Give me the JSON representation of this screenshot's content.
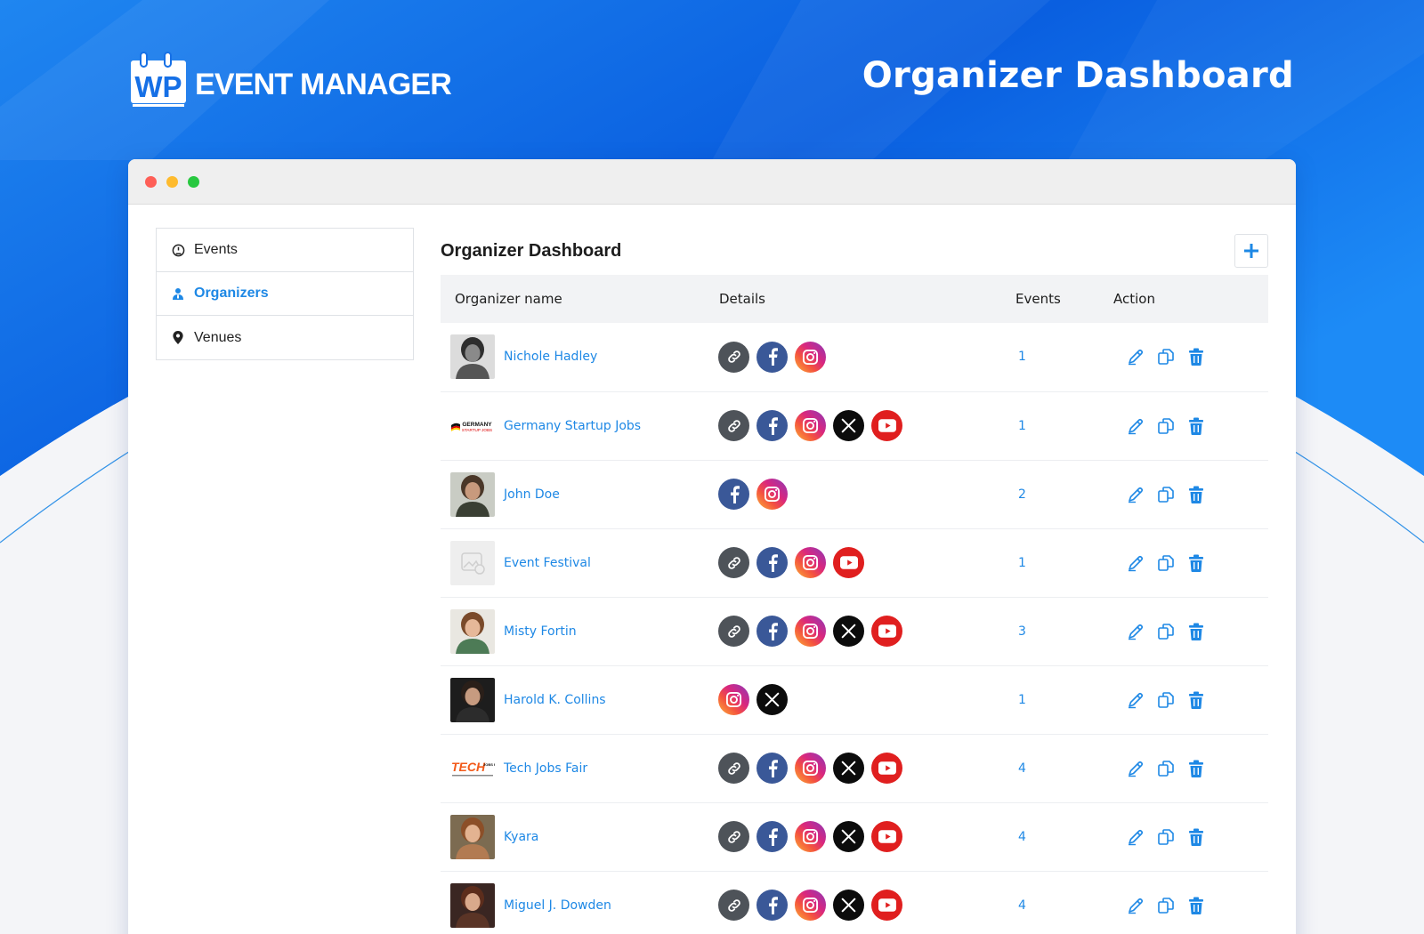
{
  "brand": {
    "logo_mark": "WP",
    "logo_text": "EVENT MANAGER"
  },
  "hero": {
    "title": "Organizer Dashboard"
  },
  "colors": {
    "accent": "#1e88e5",
    "hero_blue": "#1565e0"
  },
  "sidebar": {
    "items": [
      {
        "label": "Events",
        "icon": "dashboard-gauge-icon",
        "active": false
      },
      {
        "label": "Organizers",
        "icon": "organizer-person-icon",
        "active": true
      },
      {
        "label": "Venues",
        "icon": "map-pin-icon",
        "active": false
      }
    ]
  },
  "main": {
    "title": "Organizer Dashboard",
    "add_icon": "plus-icon",
    "columns": {
      "name": "Organizer name",
      "details": "Details",
      "events": "Events",
      "action": "Action"
    },
    "rows": [
      {
        "name": "Nichole Hadley",
        "events": "1",
        "socials": [
          "link",
          "facebook",
          "instagram"
        ]
      },
      {
        "name": "Germany Startup Jobs",
        "events": "1",
        "socials": [
          "link",
          "facebook",
          "instagram",
          "x",
          "youtube"
        ]
      },
      {
        "name": "John Doe",
        "events": "2",
        "socials": [
          "facebook",
          "instagram"
        ]
      },
      {
        "name": "Event Festival",
        "events": "1",
        "socials": [
          "link",
          "facebook",
          "instagram",
          "youtube"
        ]
      },
      {
        "name": "Misty Fortin",
        "events": "3",
        "socials": [
          "link",
          "facebook",
          "instagram",
          "x",
          "youtube"
        ]
      },
      {
        "name": "Harold K. Collins",
        "events": "1",
        "socials": [
          "instagram",
          "x"
        ]
      },
      {
        "name": "Tech Jobs Fair",
        "events": "4",
        "socials": [
          "link",
          "facebook",
          "instagram",
          "x",
          "youtube"
        ]
      },
      {
        "name": "Kyara",
        "events": "4",
        "socials": [
          "link",
          "facebook",
          "instagram",
          "x",
          "youtube"
        ]
      },
      {
        "name": "Miguel J. Dowden",
        "events": "4",
        "socials": [
          "link",
          "facebook",
          "instagram",
          "x",
          "youtube"
        ]
      }
    ],
    "avatar_logos": {
      "germany": {
        "line1": "GERMANY",
        "line2": "STARTUP JOBS"
      },
      "tech": {
        "line1": "TECH",
        "line2": "JOBS FAIR"
      }
    }
  }
}
